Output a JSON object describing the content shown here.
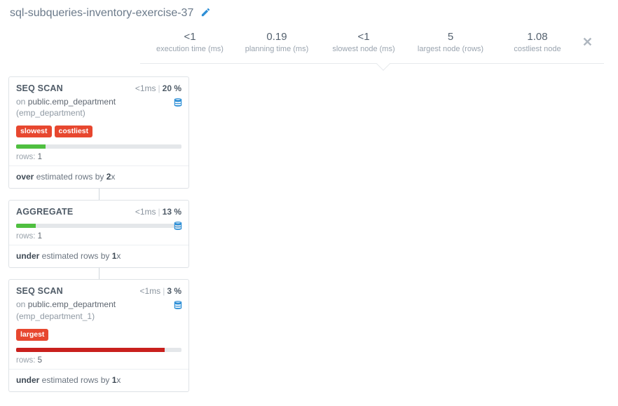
{
  "header": {
    "title": "sql-subqueries-inventory-exercise-37"
  },
  "stats": {
    "exec_time": {
      "value": "<1",
      "label": "execution time (ms)"
    },
    "plan_time": {
      "value": "0.19",
      "label": "planning time (ms)"
    },
    "slowest_node": {
      "value": "<1",
      "label": "slowest node (ms)"
    },
    "largest_node": {
      "value": "5",
      "label": "largest node (rows)"
    },
    "costliest": {
      "value": "1.08",
      "label": "costliest node"
    }
  },
  "nodes": [
    {
      "name": "SEQ SCAN",
      "time": "<1ms",
      "pct": "20 %",
      "on_prefix": "on ",
      "relation": "public.emp_department",
      "alias_suffix": " (emp_department)",
      "tags": [
        "slowest",
        "costliest"
      ],
      "bar_class": "bar-green",
      "bar_width": "18%",
      "rows_label": "rows: ",
      "rows": "1",
      "est_pre": "over",
      "est_mid": " estimated rows by ",
      "est_mult": "2",
      "est_suffix": "x"
    },
    {
      "name": "AGGREGATE",
      "time": "<1ms",
      "pct": "13 %",
      "bar_class": "bar-green",
      "bar_width": "12%",
      "rows_label": "rows: ",
      "rows": "1",
      "est_pre": "under",
      "est_mid": " estimated rows by ",
      "est_mult": "1",
      "est_suffix": "x"
    },
    {
      "name": "SEQ SCAN",
      "time": "<1ms",
      "pct": "3 %",
      "on_prefix": "on ",
      "relation": "public.emp_department",
      "alias_suffix": " (emp_department_1)",
      "tags": [
        "largest"
      ],
      "bar_class": "bar-red",
      "bar_width": "90%",
      "rows_label": "rows: ",
      "rows": "5",
      "est_pre": "under",
      "est_mid": " estimated rows by ",
      "est_mult": "1",
      "est_suffix": "x"
    }
  ]
}
